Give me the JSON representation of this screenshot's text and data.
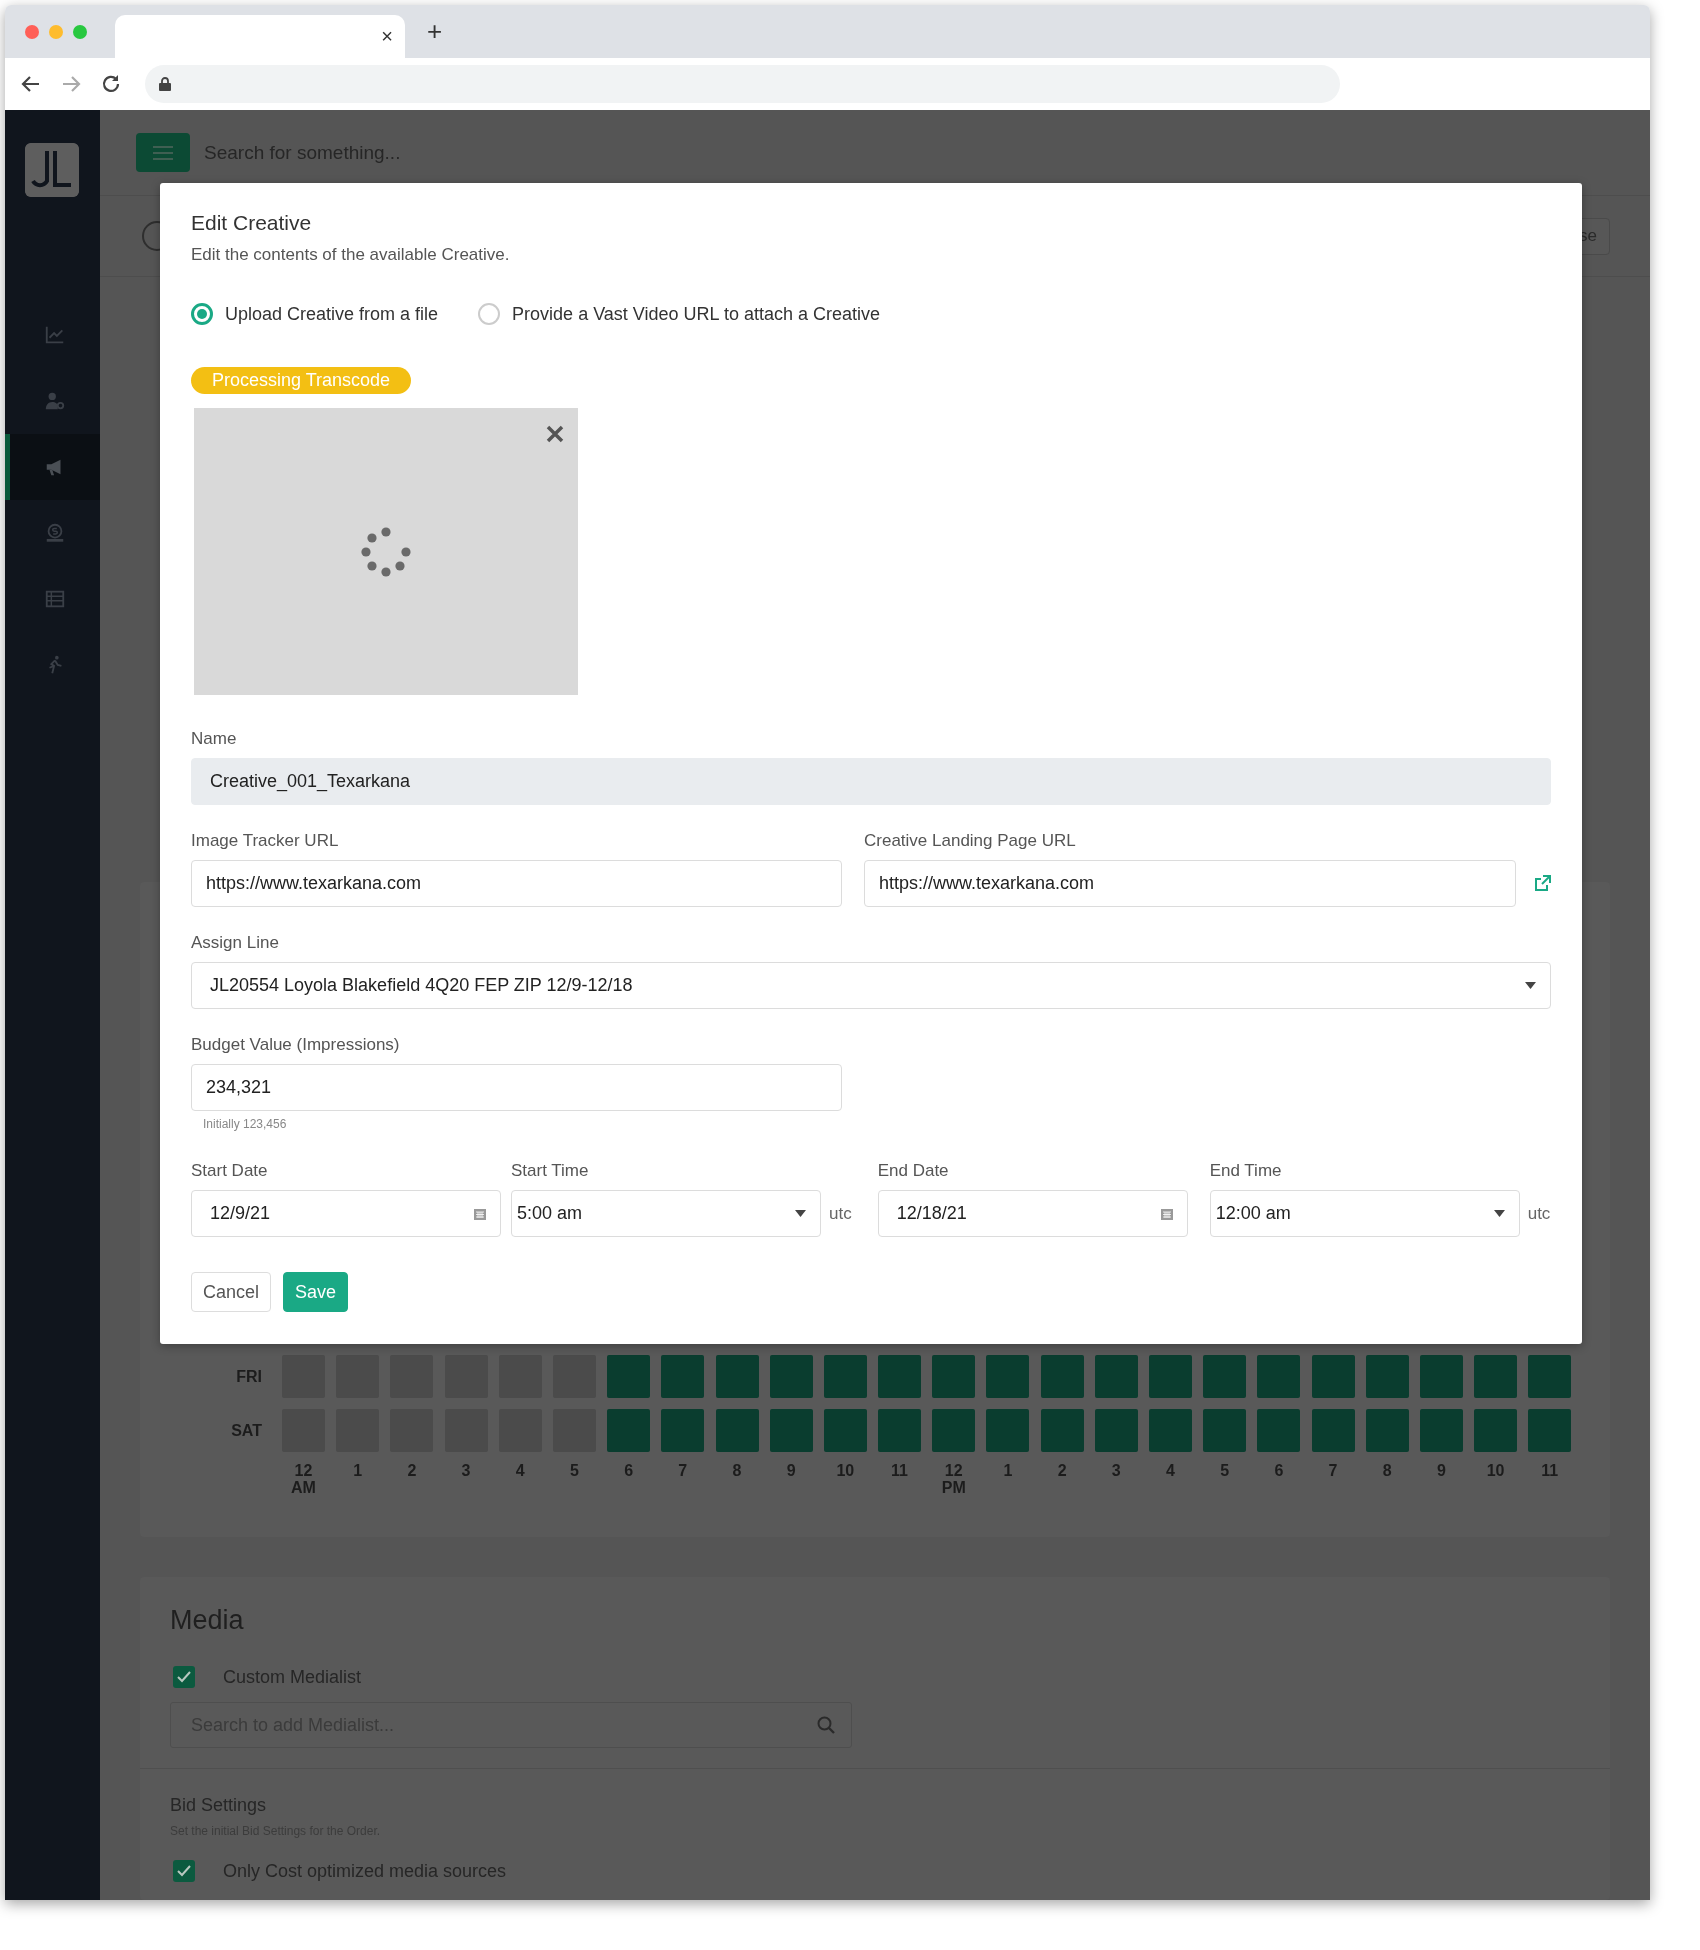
{
  "browser": {
    "tab_close": "×",
    "new_tab": "+"
  },
  "topbar": {
    "search_placeholder": "Search for something..."
  },
  "subheader": {
    "button_label": "se"
  },
  "sidebar": {
    "items": [
      {
        "kind": "chart",
        "selected": false
      },
      {
        "kind": "user-gear",
        "selected": false
      },
      {
        "kind": "megaphone",
        "selected": true
      },
      {
        "kind": "money",
        "selected": false
      },
      {
        "kind": "list",
        "selected": false
      },
      {
        "kind": "runner",
        "selected": false
      }
    ]
  },
  "modal": {
    "title": "Edit Creative",
    "subtitle": "Edit the contents of the available Creative.",
    "source_options": [
      {
        "label": "Upload Creative from a file",
        "selected": true
      },
      {
        "label": "Provide a Vast Video URL to attach a Creative",
        "selected": false
      }
    ],
    "status_badge": "Processing Transcode",
    "name": {
      "label": "Name",
      "value": "Creative_001_Texarkana",
      "disabled": true
    },
    "image_tracker": {
      "label": "Image Tracker URL",
      "value": "https://www.texarkana.com"
    },
    "landing_page": {
      "label": "Creative Landing Page URL",
      "value": "https://www.texarkana.com"
    },
    "assign_line": {
      "label": "Assign Line",
      "value": "JL20554 Loyola Blakefield 4Q20 FEP ZIP 12/9-12/18"
    },
    "budget": {
      "label": "Budget Value (Impressions)",
      "value": "234,321",
      "hint": "Initially 123,456"
    },
    "schedule_fields": [
      {
        "kind": "date",
        "label": "Start Date",
        "value": "12/9/21"
      },
      {
        "kind": "time",
        "label": "Start Time",
        "value": "5:00 am",
        "suffix": "utc"
      },
      {
        "kind": "date",
        "label": "End Date",
        "value": "12/18/21"
      },
      {
        "kind": "time",
        "label": "End Time",
        "value": "12:00 am",
        "suffix": "utc"
      }
    ],
    "buttons": [
      {
        "kind": "secondary",
        "label": "Cancel"
      },
      {
        "kind": "primary",
        "label": "Save"
      }
    ]
  },
  "schedule": {
    "rows": [
      {
        "day": "FRI",
        "hours": [
          false,
          false,
          false,
          false,
          false,
          false,
          true,
          true,
          true,
          true,
          true,
          true,
          true,
          true,
          true,
          true,
          true,
          true,
          true,
          true,
          true,
          true,
          true,
          true
        ]
      },
      {
        "day": "SAT",
        "hours": [
          false,
          false,
          false,
          false,
          false,
          false,
          true,
          true,
          true,
          true,
          true,
          true,
          true,
          true,
          true,
          true,
          true,
          true,
          true,
          true,
          true,
          true,
          true,
          true
        ]
      }
    ],
    "hour_labels": [
      "12 AM",
      "1",
      "2",
      "3",
      "4",
      "5",
      "6",
      "7",
      "8",
      "9",
      "10",
      "11",
      "12 PM",
      "1",
      "2",
      "3",
      "4",
      "5",
      "6",
      "7",
      "8",
      "9",
      "10",
      "11"
    ]
  },
  "media": {
    "title": "Media",
    "custom_medialist": {
      "label": "Custom Medialist",
      "checked": true
    },
    "search_placeholder": "Search to add Medialist..."
  },
  "bid_settings": {
    "title": "Bid Settings",
    "subtitle": "Set the initial Bid Settings for the Order.",
    "options": [
      {
        "label": "Only Cost optimized media sources",
        "checked": true
      }
    ]
  }
}
